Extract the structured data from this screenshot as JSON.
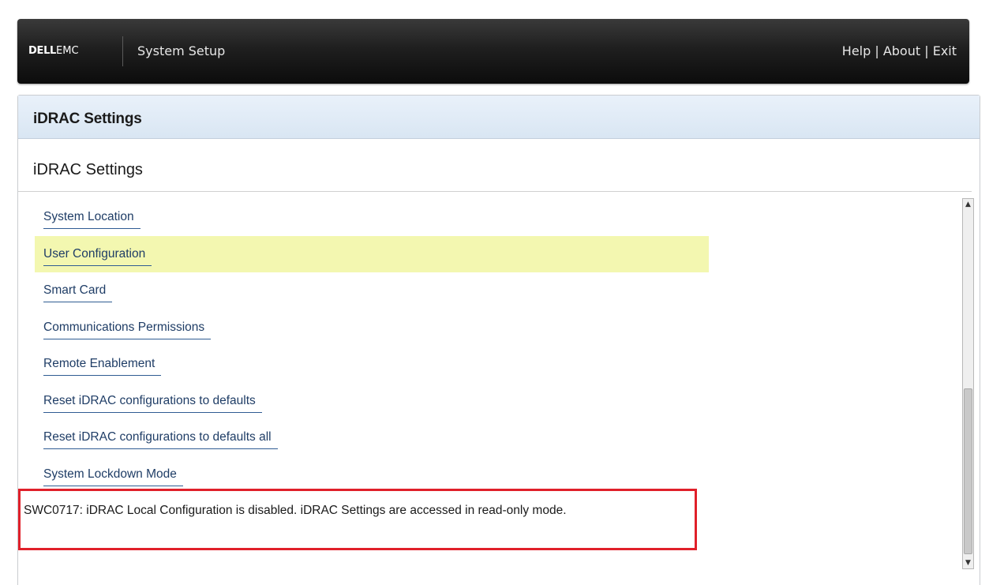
{
  "header": {
    "brand_bold": "DELL",
    "brand_light": "EMC",
    "app_title": "System Setup",
    "links": [
      "Help",
      "About",
      "Exit"
    ],
    "separator": " | "
  },
  "panel": {
    "header_title": "iDRAC Settings",
    "section_title": "iDRAC Settings"
  },
  "menu": {
    "items": [
      {
        "label": "System Location",
        "selected": false
      },
      {
        "label": "User Configuration",
        "selected": true
      },
      {
        "label": "Smart Card",
        "selected": false
      },
      {
        "label": "Communications Permissions",
        "selected": false
      },
      {
        "label": "Remote Enablement",
        "selected": false
      },
      {
        "label": "Reset iDRAC configurations to defaults",
        "selected": false
      },
      {
        "label": "Reset iDRAC configurations to defaults all",
        "selected": false
      },
      {
        "label": "System Lockdown Mode",
        "selected": false
      }
    ]
  },
  "message": {
    "text": "SWC0717: iDRAC Local Configuration is disabled. iDRAC Settings are accessed in read-only mode."
  },
  "scrollbar": {
    "up_icon": "scroll-up-arrow-icon",
    "down_icon": "scroll-down-arrow-icon"
  },
  "colors": {
    "selected_highlight": "#f3f7b0",
    "link": "#1f3d66",
    "alert_border": "#e0202a"
  }
}
